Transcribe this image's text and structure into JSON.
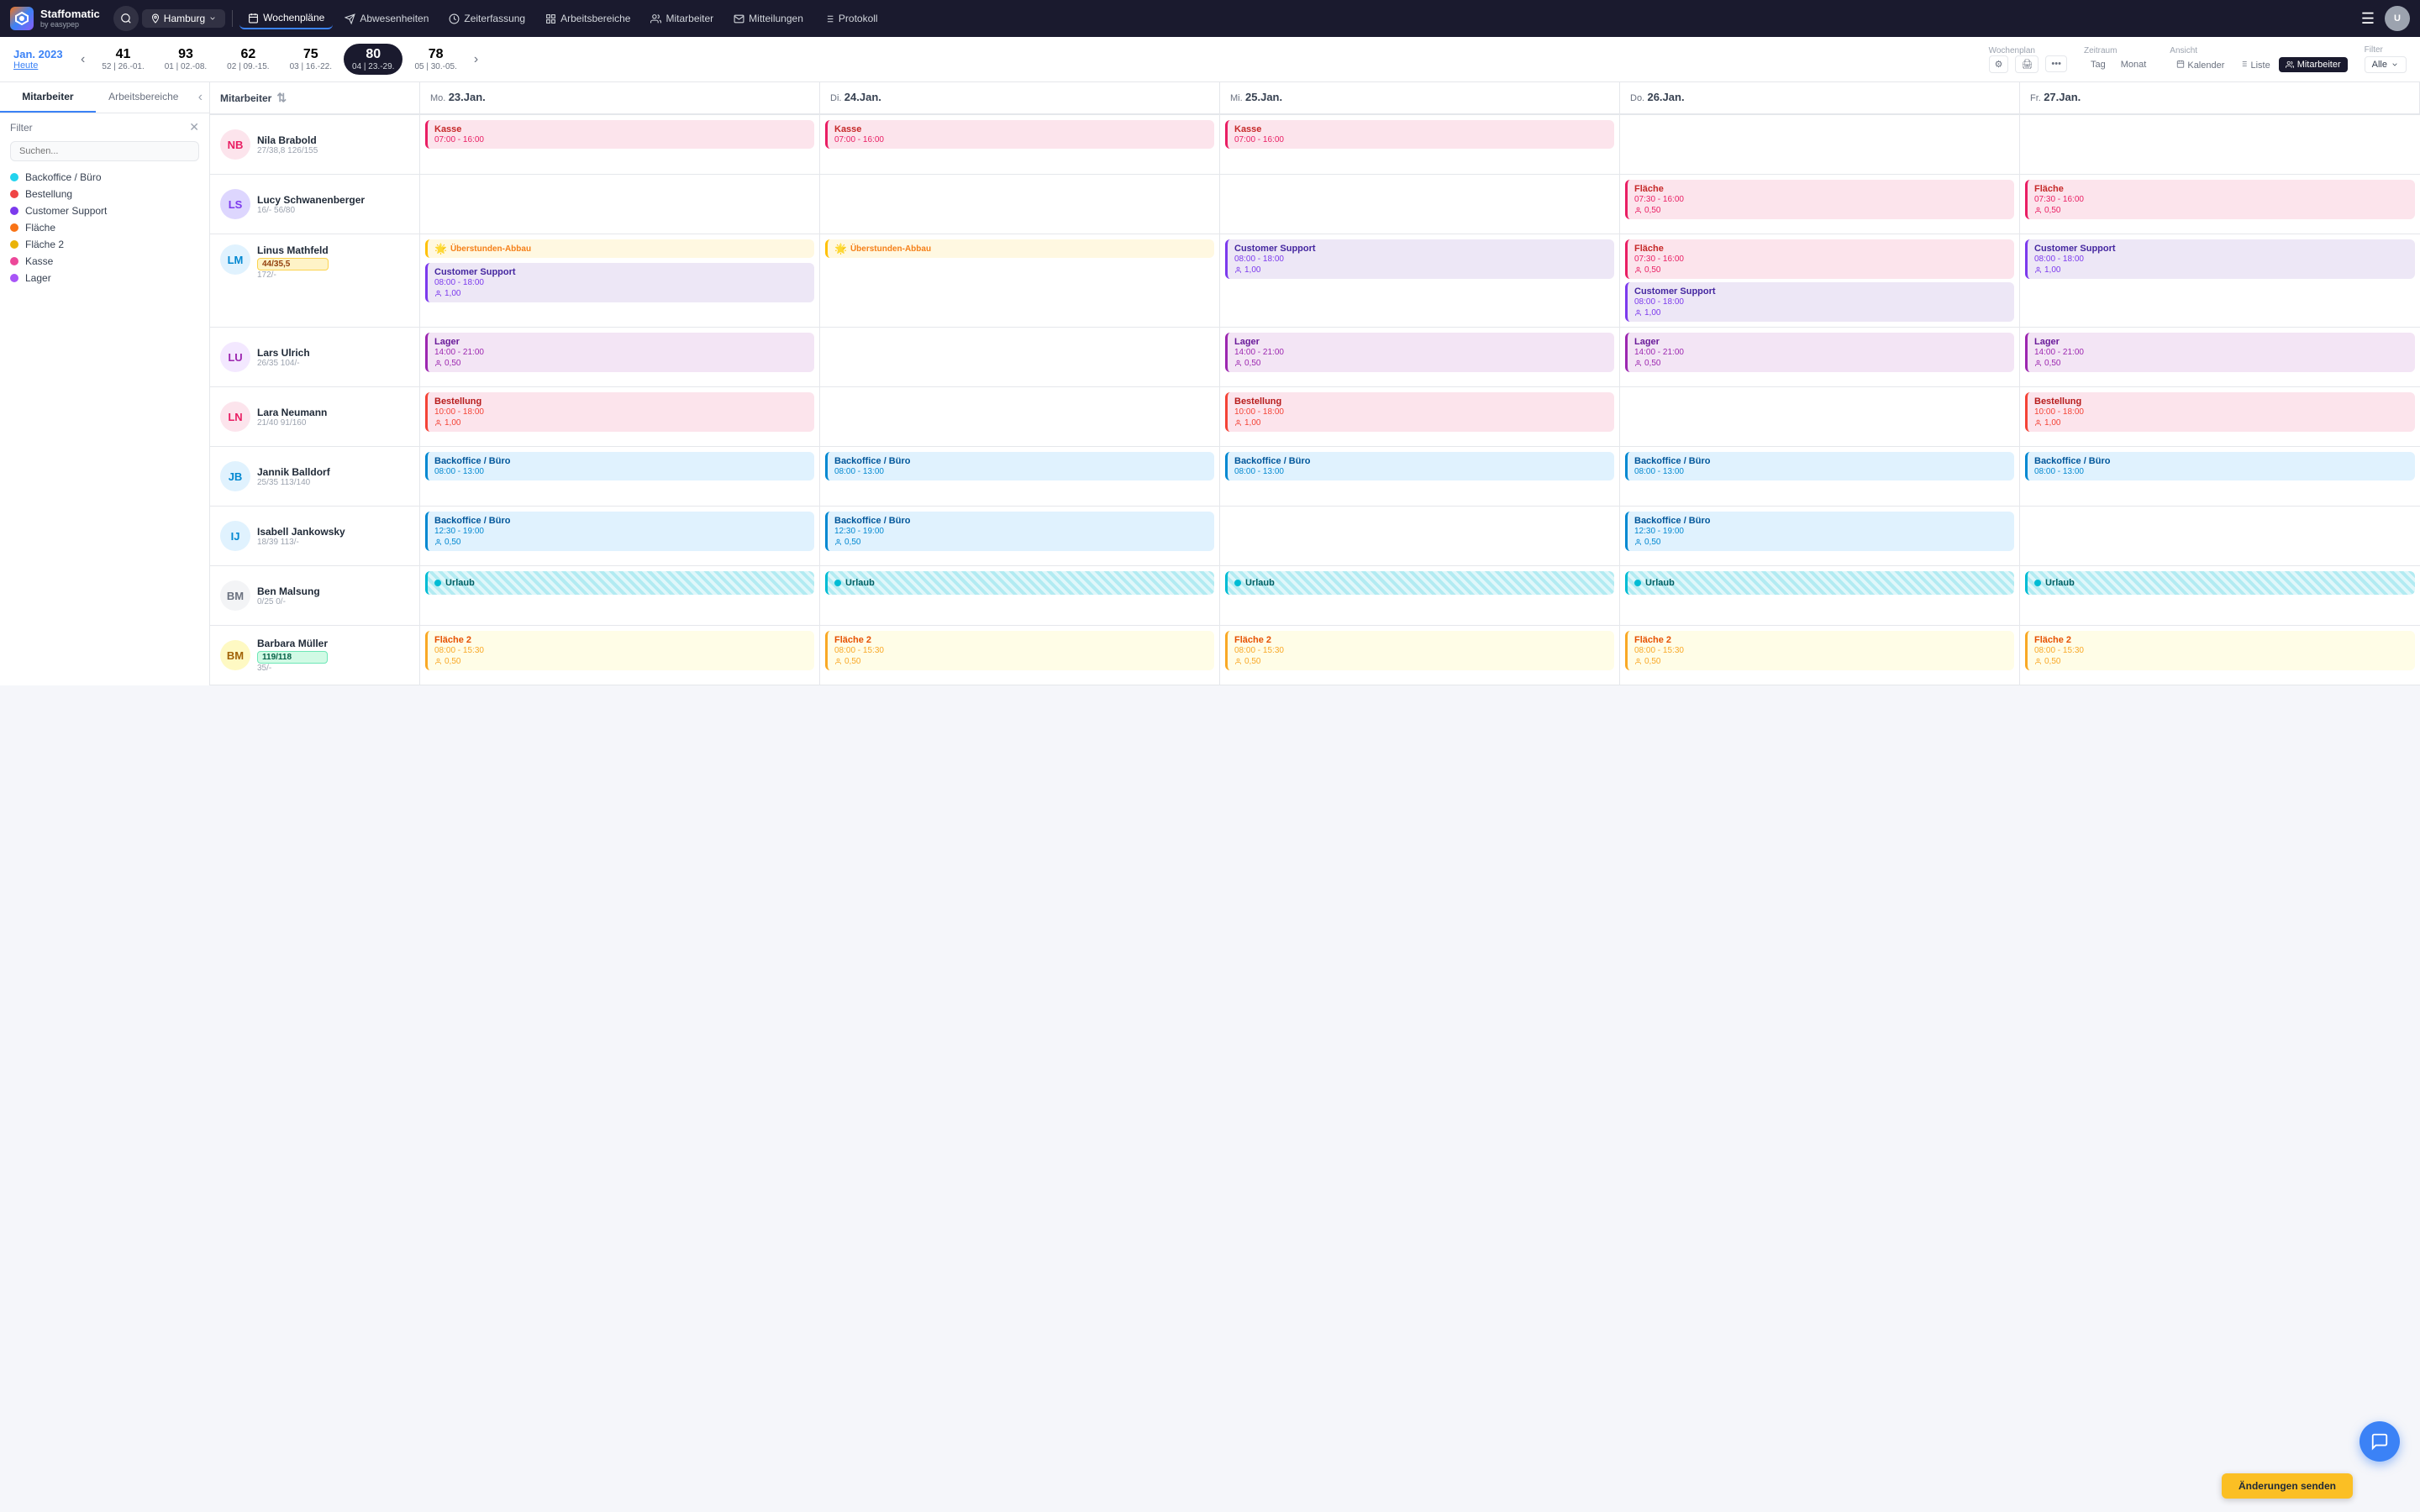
{
  "app": {
    "logo_text": "Staffomatic",
    "logo_sub": "by easypep"
  },
  "topnav": {
    "location": "Hamburg",
    "items": [
      {
        "label": "Wochenpläne",
        "active": true,
        "icon": "calendar-icon"
      },
      {
        "label": "Abwesenheiten",
        "active": false,
        "icon": "plane-icon"
      },
      {
        "label": "Zeiterfassung",
        "active": false,
        "icon": "clock-icon"
      },
      {
        "label": "Arbeitsbereiche",
        "active": false,
        "icon": "grid-icon"
      },
      {
        "label": "Mitarbeiter",
        "active": false,
        "icon": "people-icon"
      },
      {
        "label": "Mitteilungen",
        "active": false,
        "icon": "mail-icon"
      },
      {
        "label": "Protokoll",
        "active": false,
        "icon": "list-icon"
      }
    ]
  },
  "weekbar": {
    "month_year": "Jan. 2023",
    "today_label": "Heute",
    "weeks": [
      {
        "num": "41",
        "range": "52 | 26.-01."
      },
      {
        "num": "93",
        "range": "01 | 02.-08."
      },
      {
        "num": "62",
        "range": "02 | 09.-15."
      },
      {
        "num": "75",
        "range": "03 | 16.-22."
      },
      {
        "num": "80",
        "range": "04 | 23.-29.",
        "active": true
      },
      {
        "num": "78",
        "range": "05 | 30.-05."
      }
    ],
    "wochenplan_label": "Wochenplan",
    "zeitraum_label": "Zeitraum",
    "zeitraum_options": [
      "Tag",
      "Monat"
    ],
    "ansicht_label": "Ansicht",
    "ansicht_options": [
      "Kalender",
      "Liste",
      "Mitarbeiter"
    ],
    "ansicht_active": "Mitarbeiter",
    "filter_label": "Filter",
    "filter_value": "Alle"
  },
  "sidebar": {
    "tab_mitarbeiter": "Mitarbeiter",
    "tab_arbeitsbereiche": "Arbeitsbereiche",
    "filter_label": "Filter",
    "search_placeholder": "Suchen...",
    "filter_items": [
      {
        "label": "Backoffice / Büro",
        "color": "#22d3ee"
      },
      {
        "label": "Bestellung",
        "color": "#ef4444"
      },
      {
        "label": "Customer Support",
        "color": "#7c3aed"
      },
      {
        "label": "Fläche",
        "color": "#f97316"
      },
      {
        "label": "Fläche 2",
        "color": "#eab308"
      },
      {
        "label": "Kasse",
        "color": "#ec4899"
      },
      {
        "label": "Lager",
        "color": "#a855f7"
      }
    ]
  },
  "calendar": {
    "col_header": "Mitarbeiter",
    "days": [
      {
        "label": "Mo.",
        "date": "23.Jan.",
        "highlight": false
      },
      {
        "label": "Di.",
        "date": "24.Jan.",
        "highlight": false
      },
      {
        "label": "Mi.",
        "date": "25.Jan.",
        "highlight": false
      },
      {
        "label": "Do.",
        "date": "26.Jan.",
        "highlight": false
      },
      {
        "label": "Fr.",
        "date": "27.Jan.",
        "highlight": false
      }
    ],
    "employees": [
      {
        "name": "Nila Brabold",
        "stats": "27/38,8   126/155",
        "avatar_initials": "NB",
        "shifts": [
          {
            "type": "Kasse",
            "time": "07:00 - 16:00",
            "persons": null,
            "style": "kasse"
          },
          {
            "type": "Kasse",
            "time": "07:00 - 16:00",
            "persons": null,
            "style": "kasse"
          },
          {
            "type": "Kasse",
            "time": "07:00 - 16:00",
            "persons": null,
            "style": "kasse"
          },
          null,
          null
        ]
      },
      {
        "name": "Lucy Schwanenberger",
        "stats": "16/-   56/80",
        "avatar_initials": "LS",
        "shifts": [
          null,
          null,
          null,
          {
            "type": "Fläche",
            "time": "07:30 - 16:00",
            "persons": "0,50",
            "style": "flache"
          },
          {
            "type": "Fläche",
            "time": "07:30 - 16:00",
            "persons": "0,50",
            "style": "flache"
          }
        ]
      },
      {
        "name": "Linus Mathfeld",
        "stats": "172/-",
        "badge": "44/35,5",
        "badge_style": "orange",
        "avatar_initials": "LM",
        "shifts": [
          {
            "uberstunden": true,
            "type": "Customer Support",
            "time": "08:00 - 18:00",
            "persons": "1,00",
            "style": "customer-support"
          },
          {
            "uberstunden": true,
            "type_only": true
          },
          {
            "type": "Customer Support",
            "time": "08:00 - 18:00",
            "persons": "1,00",
            "style": "customer-support"
          },
          {
            "type": "Fläche",
            "time": "07:30 - 16:00",
            "persons": "0,50",
            "style": "flache",
            "extra": {
              "type": "Customer Support",
              "time": "08:00 - 18:00",
              "persons": "1,00",
              "style": "customer-support"
            }
          },
          {
            "type": "Customer Support",
            "time": "08:00 - 18:00",
            "persons": "1,00",
            "style": "customer-support"
          }
        ]
      },
      {
        "name": "Lars Ulrich",
        "stats": "26/35   104/-",
        "avatar_initials": "LU",
        "shifts": [
          {
            "type": "Lager",
            "time": "14:00 - 21:00",
            "persons": "0,50",
            "style": "lager"
          },
          null,
          {
            "type": "Lager",
            "time": "14:00 - 21:00",
            "persons": "0,50",
            "style": "lager"
          },
          {
            "type": "Lager",
            "time": "14:00 - 21:00",
            "persons": "0,50",
            "style": "lager"
          },
          {
            "type": "Lager",
            "time": "14:00 - 21:00",
            "persons": "0,50",
            "style": "lager"
          }
        ]
      },
      {
        "name": "Lara Neumann",
        "stats": "21/40   91/160",
        "avatar_initials": "LN",
        "shifts": [
          {
            "type": "Bestellung",
            "time": "10:00 - 18:00",
            "persons": "1,00",
            "style": "bestellung"
          },
          null,
          {
            "type": "Bestellung",
            "time": "10:00 - 18:00",
            "persons": "1,00",
            "style": "bestellung"
          },
          null,
          {
            "type": "Bestellung",
            "time": "10:00 - 18:00",
            "persons": "1,00",
            "style": "bestellung"
          }
        ]
      },
      {
        "name": "Jannik Balldorf",
        "stats": "25/35   113/140",
        "avatar_initials": "JB",
        "shifts": [
          {
            "type": "Backoffice / Büro",
            "time": "08:00 - 13:00",
            "style": "backoffice"
          },
          {
            "type": "Backoffice / Büro",
            "time": "08:00 - 13:00",
            "style": "backoffice"
          },
          {
            "type": "Backoffice / Büro",
            "time": "08:00 - 13:00",
            "style": "backoffice"
          },
          {
            "type": "Backoffice / Büro",
            "time": "08:00 - 13:00",
            "style": "backoffice"
          },
          {
            "type": "Backoffice / Büro",
            "time": "08:00 - 13:00",
            "style": "backoffice"
          }
        ]
      },
      {
        "name": "Isabell Jankowsky",
        "stats": "18/39   113/-",
        "avatar_initials": "IJ",
        "shifts": [
          {
            "type": "Backoffice / Büro",
            "time": "12:30 - 19:00",
            "persons": "0,50",
            "style": "backoffice"
          },
          {
            "type": "Backoffice / Büro",
            "time": "12:30 - 19:00",
            "persons": "0,50",
            "style": "backoffice"
          },
          null,
          {
            "type": "Backoffice / Büro",
            "time": "12:30 - 19:00",
            "persons": "0,50",
            "style": "backoffice"
          },
          null
        ]
      },
      {
        "name": "Ben Malsung",
        "stats": "0/25   0/-",
        "avatar_initials": "BM",
        "shifts": [
          {
            "urlaub": true
          },
          {
            "urlaub": true
          },
          {
            "urlaub": true
          },
          {
            "urlaub": true
          },
          {
            "urlaub": true
          }
        ]
      },
      {
        "name": "Barbara Müller",
        "stats": "35/-",
        "badge": "119/118",
        "badge_style": "green",
        "avatar_initials": "BM2",
        "shifts": [
          {
            "type": "Fläche 2",
            "time": "08:00 - 15:30",
            "persons": "0,50",
            "style": "flache2"
          },
          {
            "type": "Fläche 2",
            "time": "08:00 - 15:30",
            "persons": "0,50",
            "style": "flache2"
          },
          {
            "type": "Fläche 2",
            "time": "08:00 - 15:30",
            "persons": "0,50",
            "style": "flache2"
          },
          {
            "type": "Fläche 2",
            "time": "08:00 - 15:30",
            "persons": "0,50",
            "style": "flache2"
          },
          {
            "type": "Fläche 2",
            "time": "08:00 - 15:30",
            "persons": "0,50",
            "style": "flache2"
          }
        ]
      }
    ]
  },
  "buttons": {
    "save_label": "Änderungen senden",
    "urlaub_label": "Urlaub",
    "uberstunden_label": "Überstunden-Abbau"
  }
}
